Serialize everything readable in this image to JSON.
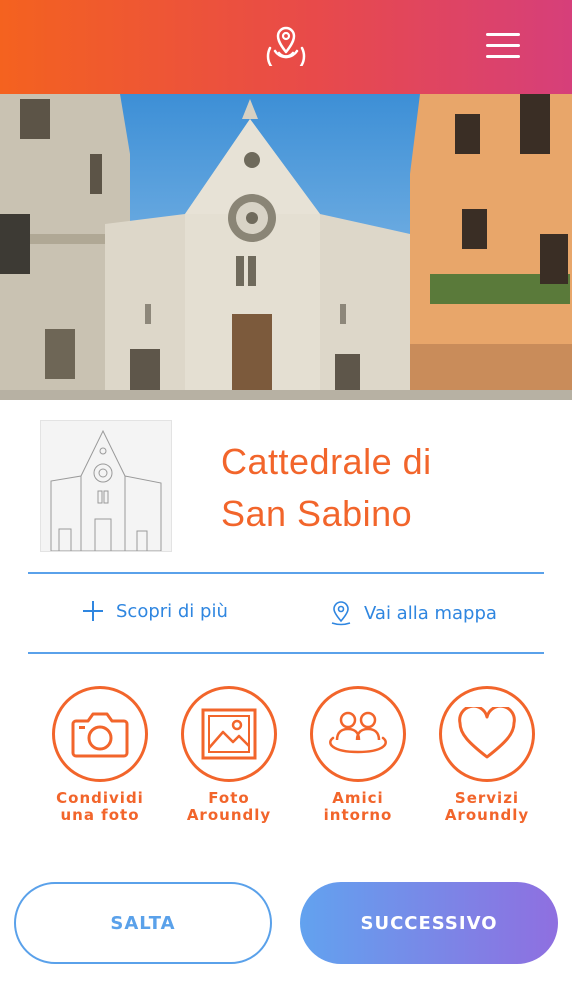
{
  "header": {
    "logo_icon": "map-pin-logo-icon",
    "menu_icon": "hamburger-menu-icon",
    "gradient_start": "#f4621f",
    "gradient_end": "#d63f7a"
  },
  "place": {
    "title_line1": "Cattedrale di",
    "title_line2": "San Sabino",
    "title_color": "#f2652b"
  },
  "links": {
    "discover_label": "Scopri di più",
    "discover_icon": "plus-icon",
    "map_label": "Vai alla mappa",
    "map_icon": "map-pin-icon",
    "color": "#2f86e0"
  },
  "features": [
    {
      "line1": "Condividi",
      "line2": "una foto",
      "icon": "camera-icon"
    },
    {
      "line1": "Foto",
      "line2": "Aroundly",
      "icon": "image-icon"
    },
    {
      "line1": "Amici",
      "line2": "intorno",
      "icon": "friends-icon"
    },
    {
      "line1": "Servizi",
      "line2": "Aroundly",
      "icon": "heart-icon"
    }
  ],
  "buttons": {
    "skip_label": "SALTA",
    "next_label": "SUCCESSIVO",
    "accent": "#5aa1ea"
  }
}
